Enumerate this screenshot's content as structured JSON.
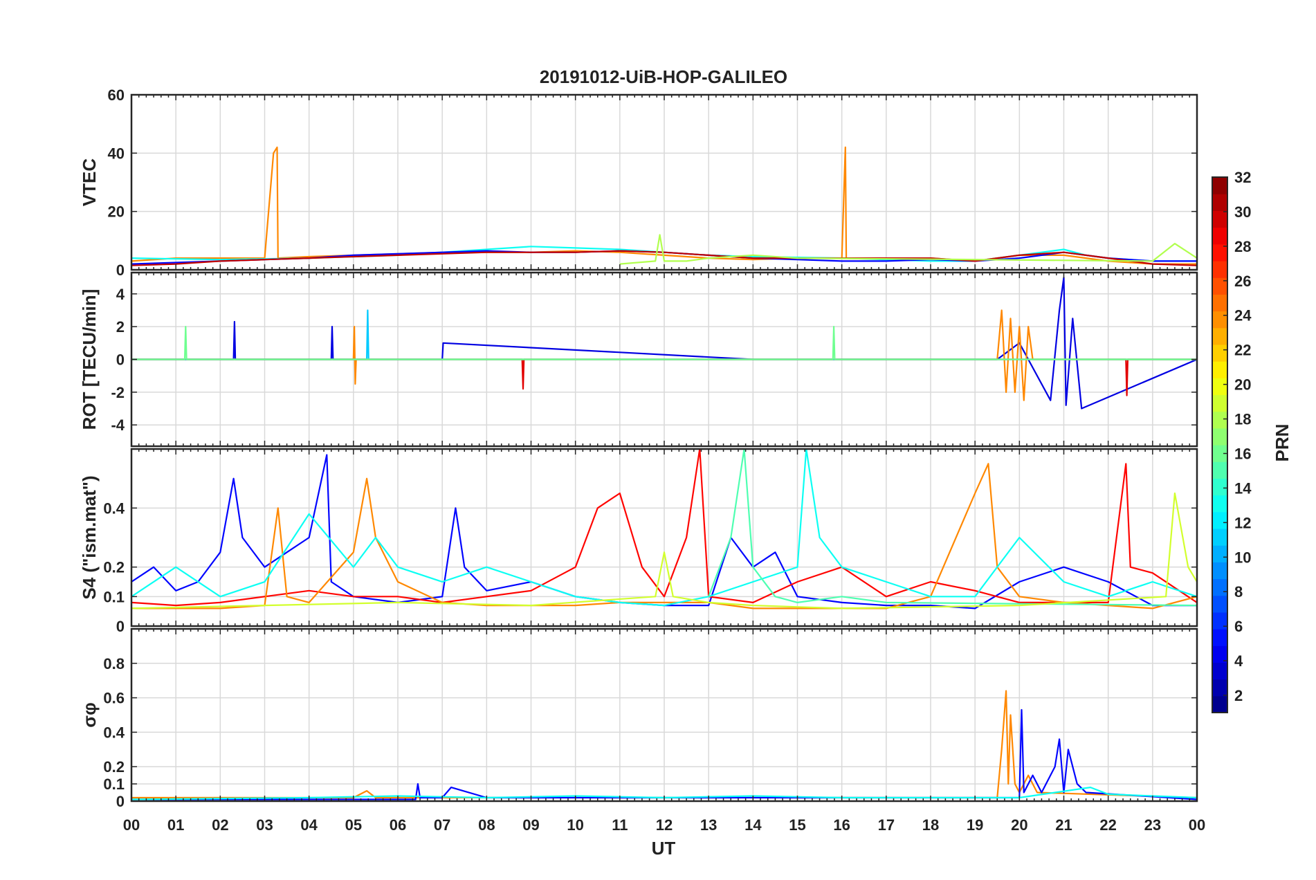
{
  "chart_data": {
    "type": "line",
    "title": "20191012-UiB-HOP-GALILEO",
    "xlabel": "UT",
    "x_ticks": [
      "00",
      "01",
      "02",
      "03",
      "04",
      "05",
      "06",
      "07",
      "08",
      "09",
      "10",
      "11",
      "12",
      "13",
      "14",
      "15",
      "16",
      "17",
      "18",
      "19",
      "20",
      "21",
      "22",
      "23",
      "00"
    ],
    "x_range_hours": [
      0,
      24
    ],
    "grid": true,
    "colorbar": {
      "label": "PRN",
      "range": [
        1,
        32
      ],
      "ticks": [
        "2",
        "4",
        "6",
        "8",
        "10",
        "12",
        "14",
        "16",
        "18",
        "20",
        "22",
        "24",
        "26",
        "28",
        "30",
        "32"
      ],
      "colormap": "jet"
    },
    "panels": [
      {
        "id": "vtec",
        "ylabel": "VTEC",
        "ylim": [
          0,
          60
        ],
        "y_ticks": [
          "0",
          "20",
          "40",
          "60"
        ],
        "tick_values": [
          0,
          20,
          40,
          60
        ],
        "series": [
          {
            "prn": 24,
            "x": [
              0,
              1,
              2,
              3,
              3.2,
              3.28,
              3.3,
              4,
              5,
              6,
              7,
              8,
              9,
              10,
              11,
              12,
              13,
              14,
              15,
              16,
              16.08,
              16.1,
              17,
              18,
              19,
              20,
              21,
              22,
              23,
              24
            ],
            "y": [
              3,
              4,
              4,
              4,
              40,
              42,
              4,
              4.5,
              5,
              5.5,
              6,
              6,
              6,
              6.5,
              6,
              5,
              4,
              3.5,
              4,
              4,
              42,
              4,
              4,
              4,
              3,
              5,
              5,
              3,
              2,
              2
            ]
          },
          {
            "prn": 13,
            "x": [
              0,
              2,
              4,
              6,
              8,
              9,
              10,
              11,
              12,
              13,
              14,
              16,
              18,
              19,
              20,
              20.5,
              21,
              21.5,
              22,
              23,
              24
            ],
            "y": [
              4,
              3.5,
              4,
              5,
              7,
              8,
              7.5,
              7,
              6,
              5,
              4.5,
              4,
              3,
              3,
              5,
              6,
              7,
              5,
              4,
              3,
              3
            ]
          },
          {
            "prn": 5,
            "x": [
              0,
              1,
              2,
              3,
              4,
              5,
              6,
              7,
              8,
              9,
              10,
              11,
              12,
              13,
              14,
              15,
              16,
              17,
              18,
              19,
              20,
              21,
              22,
              23,
              24
            ],
            "y": [
              2,
              2.5,
              3,
              3.5,
              4,
              5,
              5.5,
              6,
              6.5,
              6,
              6,
              6.5,
              6,
              5,
              4,
              3.5,
              3,
              3,
              3.5,
              3,
              4,
              6,
              4,
              3,
              3
            ]
          },
          {
            "prn": 30,
            "x": [
              0,
              1,
              2,
              3,
              4,
              5,
              6,
              7,
              8,
              9,
              10,
              11,
              12,
              13,
              14,
              15,
              16,
              17,
              18,
              19,
              20,
              21,
              22,
              23,
              24
            ],
            "y": [
              1.5,
              2,
              3,
              3.5,
              4,
              4.5,
              5,
              5.5,
              6,
              6,
              6,
              6.5,
              6,
              5,
              4,
              4,
              4,
              4,
              4,
              3,
              5,
              6,
              4,
              2,
              1.5
            ]
          },
          {
            "prn": 18,
            "x": [
              11,
              11.8,
              11.9,
              12,
              12.5,
              13,
              14,
              15,
              23,
              23.5,
              24
            ],
            "y": [
              2,
              3,
              12,
              3,
              3,
              4,
              5,
              4,
              3,
              9,
              4
            ]
          }
        ]
      },
      {
        "id": "rot",
        "ylabel": "ROT [TECU/min]",
        "ylim": [
          -5.3,
          5.3
        ],
        "y_ticks": [
          "-4",
          "-2",
          "0",
          "2",
          "4"
        ],
        "tick_values": [
          -4,
          -2,
          0,
          2,
          4
        ],
        "series": [
          {
            "prn": 4,
            "x": [
              0,
              2.3,
              2.32,
              2.34,
              4.5,
              4.52,
              4.54,
              7,
              7.02,
              14,
              19.5,
              20,
              20.7,
              20.9,
              21,
              21.05,
              21.2,
              21.4,
              24
            ],
            "y": [
              0,
              0,
              2.3,
              0,
              0,
              2,
              0,
              0,
              1,
              0,
              0,
              1,
              -2.5,
              3,
              5,
              -2.8,
              2.5,
              -3,
              0
            ]
          },
          {
            "prn": 24,
            "x": [
              0,
              5,
              5.02,
              5.04,
              5.06,
              19.5,
              19.6,
              19.7,
              19.8,
              19.9,
              20,
              20.1,
              20.2,
              20.3,
              20.5,
              24
            ],
            "y": [
              0,
              0,
              2,
              -1.5,
              0,
              0,
              3,
              -2,
              2.5,
              -2,
              2,
              -2.5,
              2,
              0,
              0,
              0
            ]
          },
          {
            "prn": 29,
            "x": [
              0,
              8.8,
              8.82,
              8.84,
              22.4,
              22.42,
              22.44,
              24
            ],
            "y": [
              0,
              0,
              -1.8,
              0,
              0,
              -2.2,
              0,
              0
            ]
          },
          {
            "prn": 11,
            "x": [
              0,
              5.3,
              5.32,
              5.34,
              24
            ],
            "y": [
              0,
              0,
              3,
              0,
              0
            ]
          },
          {
            "prn": 16,
            "x": [
              0,
              1.2,
              1.22,
              1.24,
              15.8,
              15.82,
              15.84,
              24
            ],
            "y": [
              0,
              0,
              2,
              0,
              0,
              2,
              0,
              0
            ]
          }
        ]
      },
      {
        "id": "s4",
        "ylabel": "S4 (\"ism.mat\")",
        "ylim": [
          0,
          0.6
        ],
        "y_ticks": [
          "0",
          "0.1",
          "0.2",
          "0.4"
        ],
        "tick_values": [
          0,
          0.1,
          0.2,
          0.4
        ],
        "series": [
          {
            "prn": 5,
            "x": [
              0,
              0.5,
              1,
              1.5,
              2,
              2.3,
              2.5,
              3,
              3.5,
              4,
              4.4,
              4.5,
              5,
              6,
              7,
              7.3,
              7.5,
              8,
              9,
              10,
              11,
              12,
              13,
              13.5,
              14,
              14.5,
              15,
              16,
              17,
              18,
              19,
              20,
              21,
              22,
              23,
              24
            ],
            "y": [
              0.15,
              0.2,
              0.12,
              0.15,
              0.25,
              0.5,
              0.3,
              0.2,
              0.25,
              0.3,
              0.58,
              0.15,
              0.1,
              0.08,
              0.1,
              0.4,
              0.2,
              0.12,
              0.15,
              0.1,
              0.08,
              0.07,
              0.07,
              0.3,
              0.2,
              0.25,
              0.1,
              0.08,
              0.07,
              0.07,
              0.06,
              0.15,
              0.2,
              0.15,
              0.07,
              0.07
            ]
          },
          {
            "prn": 28,
            "x": [
              0,
              1,
              2,
              3,
              4,
              5,
              6,
              7,
              8,
              9,
              10,
              10.5,
              11,
              11.5,
              12,
              12.5,
              12.8,
              13,
              14,
              15,
              16,
              17,
              18,
              19,
              20,
              21,
              22,
              22.4,
              22.5,
              23,
              24
            ],
            "y": [
              0.08,
              0.07,
              0.08,
              0.1,
              0.12,
              0.1,
              0.1,
              0.08,
              0.1,
              0.12,
              0.2,
              0.4,
              0.45,
              0.2,
              0.1,
              0.3,
              0.6,
              0.1,
              0.08,
              0.15,
              0.2,
              0.1,
              0.15,
              0.12,
              0.08,
              0.08,
              0.08,
              0.55,
              0.2,
              0.18,
              0.08
            ]
          },
          {
            "prn": 24,
            "x": [
              0,
              2,
              3,
              3.3,
              3.5,
              4,
              5,
              5.3,
              5.5,
              6,
              7,
              8,
              9,
              10,
              11,
              12,
              13,
              14,
              15,
              16,
              17,
              18,
              19,
              19.3,
              19.5,
              20,
              21,
              22,
              23,
              24
            ],
            "y": [
              0.06,
              0.06,
              0.07,
              0.4,
              0.1,
              0.08,
              0.25,
              0.5,
              0.3,
              0.15,
              0.08,
              0.07,
              0.07,
              0.07,
              0.08,
              0.08,
              0.08,
              0.06,
              0.06,
              0.06,
              0.06,
              0.1,
              0.45,
              0.55,
              0.2,
              0.1,
              0.08,
              0.07,
              0.06,
              0.1
            ]
          },
          {
            "prn": 13,
            "x": [
              0,
              1,
              2,
              3,
              4,
              5,
              5.5,
              6,
              7,
              8,
              9,
              10,
              11,
              12,
              13,
              14,
              15,
              15.2,
              15.5,
              16,
              17,
              18,
              19,
              20,
              21,
              22,
              23,
              24
            ],
            "y": [
              0.1,
              0.2,
              0.1,
              0.15,
              0.38,
              0.2,
              0.3,
              0.2,
              0.15,
              0.2,
              0.15,
              0.1,
              0.08,
              0.07,
              0.1,
              0.15,
              0.2,
              0.6,
              0.3,
              0.2,
              0.15,
              0.1,
              0.1,
              0.3,
              0.15,
              0.1,
              0.15,
              0.1
            ]
          },
          {
            "prn": 15,
            "x": [
              13,
              13.5,
              13.8,
              14,
              14.5,
              15,
              16,
              17,
              24
            ],
            "y": [
              0.1,
              0.3,
              0.6,
              0.2,
              0.1,
              0.08,
              0.1,
              0.08,
              0.07
            ]
          },
          {
            "prn": 19,
            "x": [
              0,
              3,
              6,
              9,
              11.8,
              12,
              12.2,
              13,
              14,
              16,
              20,
              23.3,
              23.5,
              23.8,
              24
            ],
            "y": [
              0.06,
              0.07,
              0.08,
              0.07,
              0.1,
              0.25,
              0.1,
              0.08,
              0.07,
              0.06,
              0.07,
              0.1,
              0.45,
              0.2,
              0.15
            ]
          }
        ]
      },
      {
        "id": "sigma_phi",
        "ylabel": "σφ",
        "ylim": [
          0,
          1
        ],
        "y_ticks": [
          "0",
          "0.1",
          "0.2",
          "0.4",
          "0.6",
          "0.8"
        ],
        "tick_values": [
          0,
          0.1,
          0.2,
          0.4,
          0.6,
          0.8
        ],
        "series": [
          {
            "prn": 24,
            "x": [
              0,
              5,
              5.3,
              5.5,
              19.5,
              19.6,
              19.7,
              19.75,
              19.8,
              19.9,
              20,
              20.2,
              20.4,
              24
            ],
            "y": [
              0.02,
              0.02,
              0.06,
              0.02,
              0.02,
              0.3,
              0.64,
              0.1,
              0.5,
              0.1,
              0.05,
              0.15,
              0.05,
              0.02
            ]
          },
          {
            "prn": 5,
            "x": [
              0,
              6.4,
              6.45,
              6.5,
              7,
              7.2,
              8,
              20,
              20.05,
              20.1,
              20.3,
              20.5,
              20.8,
              20.9,
              21,
              21.1,
              21.3,
              21.5,
              24
            ],
            "y": [
              0.01,
              0.01,
              0.1,
              0.02,
              0.02,
              0.08,
              0.02,
              0.02,
              0.53,
              0.05,
              0.15,
              0.05,
              0.2,
              0.36,
              0.05,
              0.3,
              0.1,
              0.05,
              0.01
            ]
          },
          {
            "prn": 13,
            "x": [
              0,
              4,
              6,
              8,
              10,
              12,
              14,
              16,
              18,
              20,
              21.6,
              22,
              23,
              24
            ],
            "y": [
              0.01,
              0.02,
              0.03,
              0.02,
              0.03,
              0.02,
              0.03,
              0.02,
              0.02,
              0.02,
              0.08,
              0.04,
              0.03,
              0.02
            ]
          }
        ]
      }
    ]
  }
}
